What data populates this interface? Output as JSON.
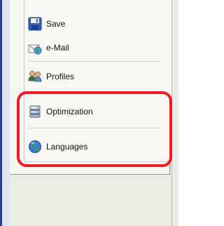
{
  "menu": {
    "items": [
      {
        "label": "Save",
        "icon": "floppy-disk-icon"
      },
      {
        "label": "e-Mail",
        "icon": "envelope-globe-icon"
      },
      {
        "label": "Profiles",
        "icon": "users-icon"
      },
      {
        "label": "Optimization",
        "icon": "optimization-icon"
      },
      {
        "label": "Languages",
        "icon": "globe-icon"
      }
    ]
  },
  "highlight": {
    "color": "#ee1c25"
  }
}
